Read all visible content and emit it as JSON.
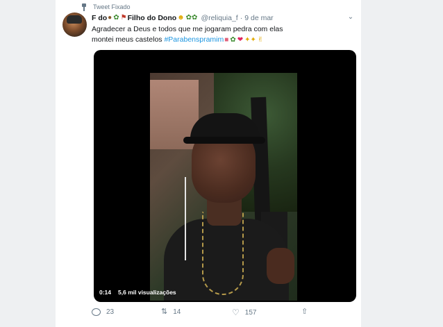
{
  "pinned_label": "Tweet Fixado",
  "author": {
    "name_part1": "F do",
    "name_part2": "Filho do Dono",
    "handle": "@reliquia_f",
    "date": "9 de mar",
    "separator": "·"
  },
  "tweet_text": {
    "body": "Agradecer a Deus e todos que me jogaram pedra com elas montei meus castelos ",
    "hashtag": "#Parabenspramim"
  },
  "video": {
    "time": "0:14",
    "views": "5,6 mil visualizações"
  },
  "actions": {
    "replies": "23",
    "retweets": "14",
    "likes": "157"
  },
  "colors": {
    "accent": "#1b95e0",
    "muted": "#657786",
    "text": "#14171a",
    "background": "#ffffff"
  },
  "icons": [
    "pin-icon",
    "reply-icon",
    "retweet-icon",
    "like-icon",
    "share-icon",
    "caret-down-icon"
  ]
}
